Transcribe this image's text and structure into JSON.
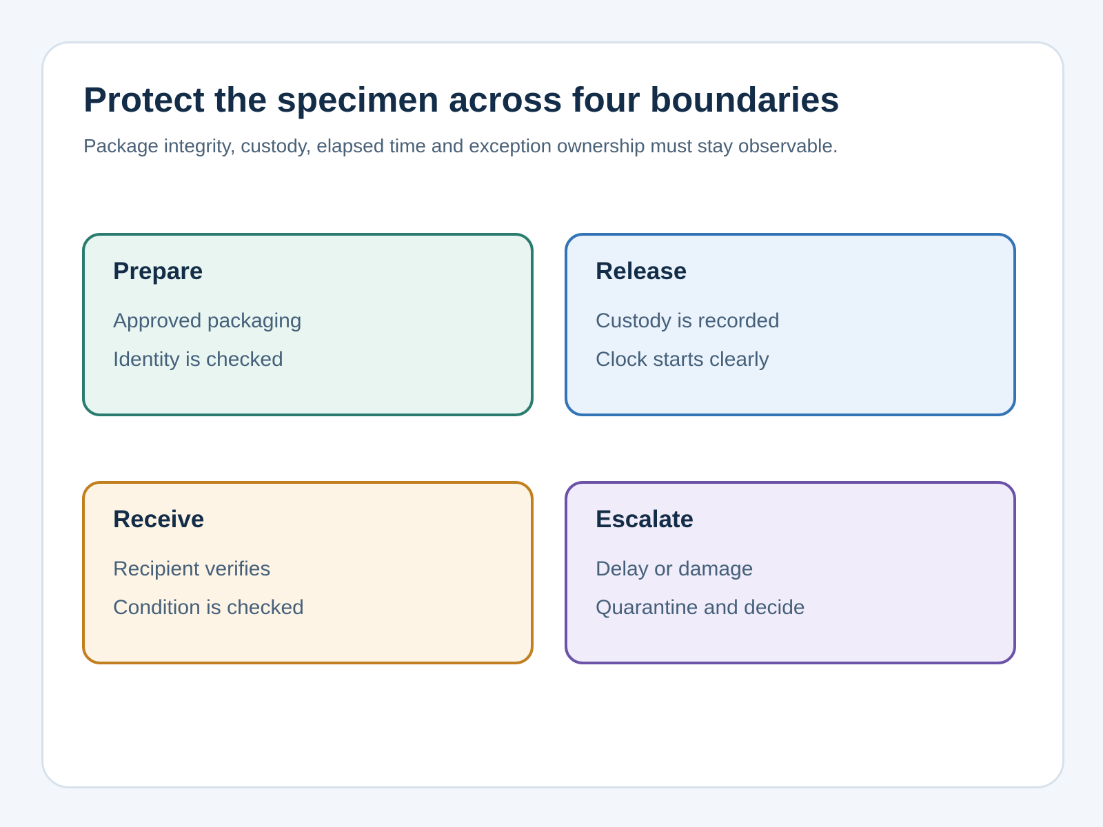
{
  "title": "Protect the specimen across four boundaries",
  "subtitle": "Package integrity, custody, elapsed time and exception ownership must stay observable.",
  "cards": [
    {
      "title": "Prepare",
      "lines": [
        "Approved packaging",
        "Identity is checked"
      ],
      "border_color": "#2a7d6e",
      "fill_color": "#e8f5f1"
    },
    {
      "title": "Release",
      "lines": [
        "Custody is recorded",
        "Clock starts clearly"
      ],
      "border_color": "#3274b5",
      "fill_color": "#eaf2fb"
    },
    {
      "title": "Receive",
      "lines": [
        "Recipient verifies",
        "Condition is checked"
      ],
      "border_color": "#c17f1f",
      "fill_color": "#fdf4e5"
    },
    {
      "title": "Escalate",
      "lines": [
        "Delay or damage",
        "Quarantine and decide"
      ],
      "border_color": "#6b53a8",
      "fill_color": "#f0ecf9"
    }
  ]
}
